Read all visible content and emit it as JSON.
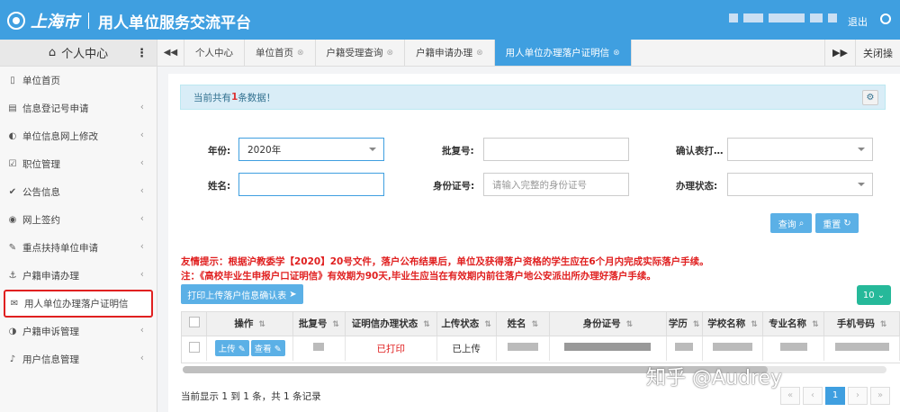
{
  "header": {
    "city_logo": "上海市",
    "platform_title": "用人单位服务交流平台",
    "logout_label": "退出"
  },
  "sidebar": {
    "title": "个人中心",
    "items": [
      {
        "label": "单位首页",
        "icon": "bookmark-icon"
      },
      {
        "label": "信息登记号申请",
        "icon": "file-icon"
      },
      {
        "label": "单位信息网上修改",
        "icon": "circle-half-icon"
      },
      {
        "label": "职位管理",
        "icon": "checkbox-icon"
      },
      {
        "label": "公告信息",
        "icon": "check-icon"
      },
      {
        "label": "网上签约",
        "icon": "eye-icon"
      },
      {
        "label": "重点扶持单位申请",
        "icon": "pencil-icon"
      },
      {
        "label": "户籍申请办理",
        "icon": "anchor-icon"
      },
      {
        "label": "用人单位办理落户证明信",
        "icon": "envelope-icon"
      },
      {
        "label": "户籍申诉管理",
        "icon": "circle-half-icon"
      },
      {
        "label": "用户信息管理",
        "icon": "bell-icon"
      }
    ]
  },
  "tabs": {
    "items": [
      "个人中心",
      "单位首页",
      "户籍受理查询",
      "户籍申请办理",
      "用人单位办理落户证明信"
    ],
    "close_label": "关闭操"
  },
  "notice": {
    "prefix": "当前共有",
    "count": "1",
    "suffix": "条数据！"
  },
  "form": {
    "year_label": "年份:",
    "year_value": "2020年",
    "approval_label": "批复号:",
    "approval_value": "",
    "confirm_label": "确认表打…",
    "confirm_value": "",
    "name_label": "姓名:",
    "name_value": "",
    "id_label": "身份证号:",
    "id_placeholder": "请输入完整的身份证号",
    "status_label": "办理状态:",
    "status_value": "",
    "query_label": "查询",
    "reset_label": "重置"
  },
  "warnings": {
    "line1": "友情提示：根据沪教委学【2020】20号文件，落户公布结果后，单位及获得落户资格的学生应在6个月内完成实际落户手续。",
    "line2": "注：《高校毕业生申报户口证明信》有效期为90天,毕业生应当在有效期内前往落户地公安派出所办理好落户手续。"
  },
  "toolbar": {
    "print_label": "打印上传落户信息确认表",
    "page_size": "10"
  },
  "table": {
    "headers": [
      "操作",
      "批复号",
      "证明信办理状态",
      "上传状态",
      "姓名",
      "身份证号",
      "学历",
      "学校名称",
      "专业名称",
      "手机号码"
    ],
    "row": {
      "upload_btn": "上传",
      "view_btn": "查看",
      "letter_status": "已打印",
      "upload_status": "已上传"
    }
  },
  "pagination": {
    "summary": "当前显示 1 到 1 条，共 1 条记录",
    "first": "«",
    "prev": "‹",
    "current": "1",
    "next": "›",
    "last": "»"
  },
  "watermark": "知乎 @Audrey",
  "colors": {
    "header_blue": "#3f9fe0",
    "warning_red": "#e02020",
    "page_size_green": "#26b99a"
  }
}
